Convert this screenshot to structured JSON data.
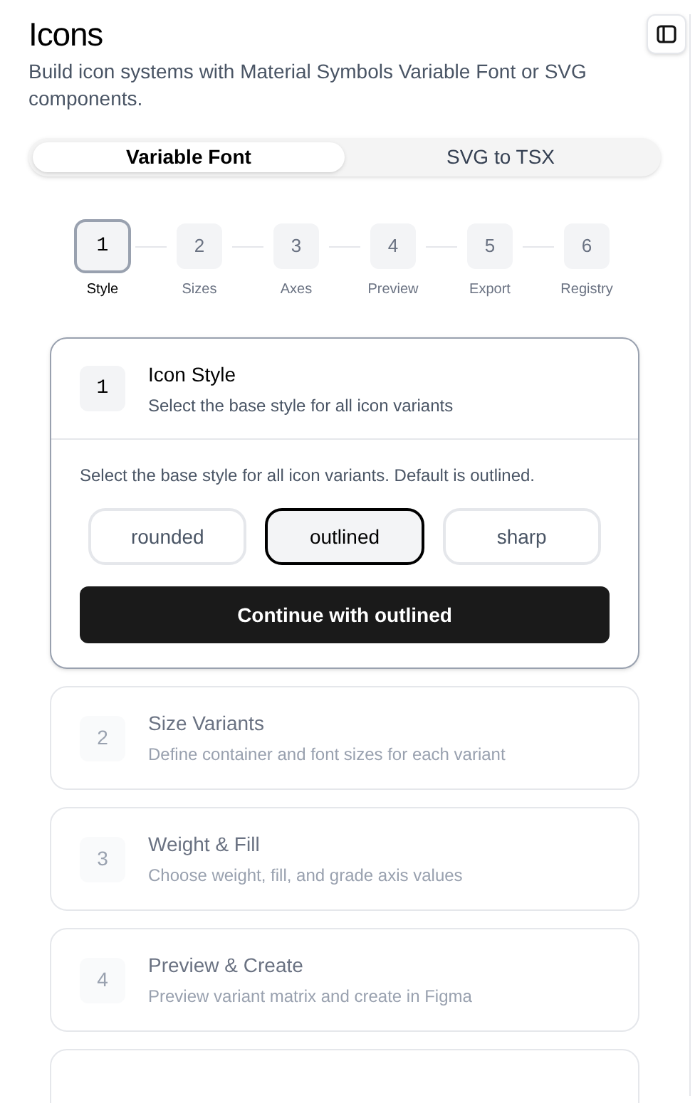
{
  "header": {
    "title": "Icons",
    "subtitle": "Build icon systems with Material Symbols Variable Font or SVG components."
  },
  "tabs": [
    {
      "label": "Variable Font",
      "selected": true
    },
    {
      "label": "SVG to TSX",
      "selected": false
    }
  ],
  "stepper": [
    {
      "number": "1",
      "label": "Style",
      "selected": true
    },
    {
      "number": "2",
      "label": "Sizes",
      "selected": false
    },
    {
      "number": "3",
      "label": "Axes",
      "selected": false
    },
    {
      "number": "4",
      "label": "Preview",
      "selected": false
    },
    {
      "number": "5",
      "label": "Export",
      "selected": false
    },
    {
      "number": "6",
      "label": "Registry",
      "selected": false
    }
  ],
  "steps": [
    {
      "number": "1",
      "title": "Icon Style",
      "description": "Select the base style for all icon variants",
      "active": true,
      "body": {
        "hint": "Select the base style for all icon variants. Default is outlined.",
        "options": [
          {
            "label": "rounded",
            "selected": false
          },
          {
            "label": "outlined",
            "selected": true
          },
          {
            "label": "sharp",
            "selected": false
          }
        ],
        "button": "Continue with outlined"
      }
    },
    {
      "number": "2",
      "title": "Size Variants",
      "description": "Define container and font sizes for each variant",
      "active": false
    },
    {
      "number": "3",
      "title": "Weight & Fill",
      "description": "Choose weight, fill, and grade axis values",
      "active": false
    },
    {
      "number": "4",
      "title": "Preview & Create",
      "description": "Preview variant matrix and create in Figma",
      "active": false
    },
    {
      "active": false
    }
  ]
}
